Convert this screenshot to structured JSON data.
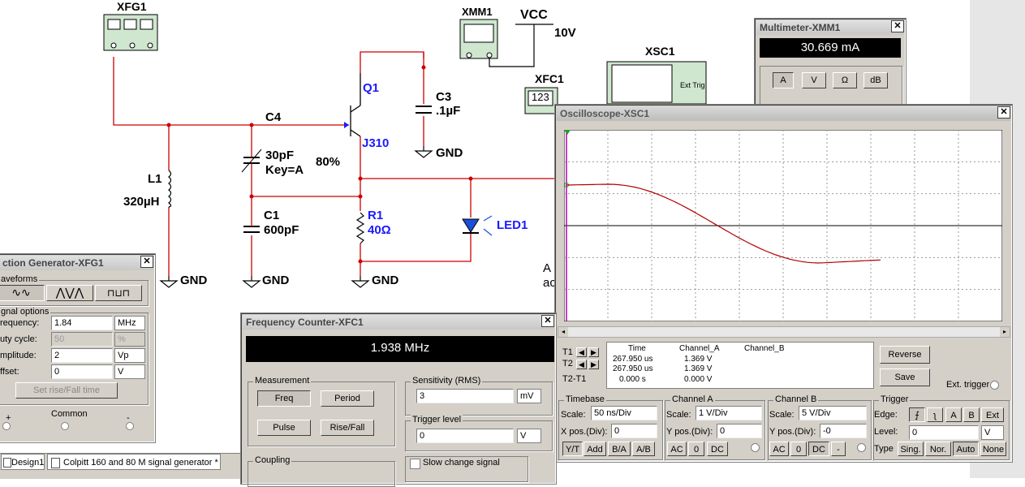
{
  "schematic": {
    "xfg1": "XFG1",
    "xmm1": "XMM1",
    "vcc": "VCC",
    "vcc_value": "10V",
    "xsc1": "XSC1",
    "xfc1": "XFC1",
    "xfc1_display": "123",
    "q1": "Q1",
    "j310": "J310",
    "c3": "C3",
    "c3_value": ".1µF",
    "c4": "C4",
    "cvar_value": "30pF",
    "cvar_key": "Key=A",
    "cvar_pct": "80%",
    "l1": "L1",
    "l1_value": "320µH",
    "c1": "C1",
    "c1_value": "600pF",
    "r1": "R1",
    "r1_value": "40Ω",
    "led1": "LED1",
    "gnd": "GND",
    "ext_trig": "Ext Trig",
    "partial_text1": "A",
    "partial_text2": "ac"
  },
  "multimeter": {
    "title": "Multimeter-XMM1",
    "reading": "30.669 mA",
    "buttons": [
      "A",
      "V",
      "Ω",
      "dB"
    ]
  },
  "oscilloscope": {
    "title": "Oscilloscope-XSC1",
    "readout": {
      "headers": [
        "Time",
        "Channel_A",
        "Channel_B"
      ],
      "rows": [
        {
          "label": "T1",
          "time": "267.950 us",
          "a": "1.369 V",
          "b": ""
        },
        {
          "label": "T2",
          "time": "267.950 us",
          "a": "1.369 V",
          "b": ""
        },
        {
          "label": "T2-T1",
          "time": "0.000 s",
          "a": "0.000 V",
          "b": ""
        }
      ]
    },
    "reverse": "Reverse",
    "save": "Save",
    "ext_trigger": "Ext. trigger",
    "timebase": {
      "title": "Timebase",
      "scale_label": "Scale:",
      "scale": "50 ns/Div",
      "xpos_label": "X pos.(Div):",
      "xpos": "0",
      "modes": [
        "Y/T",
        "Add",
        "B/A",
        "A/B"
      ]
    },
    "channel_a": {
      "title": "Channel A",
      "scale_label": "Scale:",
      "scale": "1  V/Div",
      "ypos_label": "Y pos.(Div):",
      "ypos": "0",
      "coupling": [
        "AC",
        "0",
        "DC"
      ]
    },
    "channel_b": {
      "title": "Channel B",
      "scale_label": "Scale:",
      "scale": "5  V/Div",
      "ypos_label": "Y pos.(Div):",
      "ypos": "-0",
      "coupling": [
        "AC",
        "0",
        "DC",
        "-"
      ]
    },
    "trigger": {
      "title": "Trigger",
      "edge_label": "Edge:",
      "edge_buttons": [
        "A",
        "B",
        "Ext"
      ],
      "level_label": "Level:",
      "level": "0",
      "level_unit": "V",
      "type_label": "Type",
      "types": [
        "Sing.",
        "Nor.",
        "Auto",
        "None"
      ]
    }
  },
  "function_generator": {
    "title": "ction Generator-XFG1",
    "waveforms_label": "aveforms",
    "signal_options_label": "gnal options",
    "frequency_label": "requency:",
    "frequency": "1.84",
    "frequency_unit": "MHz",
    "duty_label": "uty cycle:",
    "duty": "50",
    "duty_unit": "%",
    "amplitude_label": "mplitude:",
    "amplitude": "2",
    "amplitude_unit": "Vp",
    "offset_label": "ffset:",
    "offset": "0",
    "offset_unit": "V",
    "rise_fall": "Set rise/Fall time",
    "plus": "+",
    "common": "Common",
    "minus": "-"
  },
  "frequency_counter": {
    "title": "Frequency Counter-XFC1",
    "reading": "1.938 MHz",
    "measurement_label": "Measurement",
    "buttons": [
      "Freq",
      "Period",
      "Pulse",
      "Rise/Fall"
    ],
    "sensitivity_label": "Sensitivity (RMS)",
    "sensitivity": "3",
    "sensitivity_unit": "mV",
    "trigger_label": "Trigger level",
    "trigger": "0",
    "trigger_unit": "V",
    "coupling_label": "Coupling",
    "slow_change": "Slow change signal"
  },
  "tabs": [
    "Design1",
    "Colpitt 160 and 80 M signal generator *"
  ],
  "colors": {
    "wire": "#cc0000",
    "blue_label": "#1a1aff",
    "trace": "#b00000",
    "cursor": "#b000b0",
    "window_bg": "#d4d0c8"
  }
}
